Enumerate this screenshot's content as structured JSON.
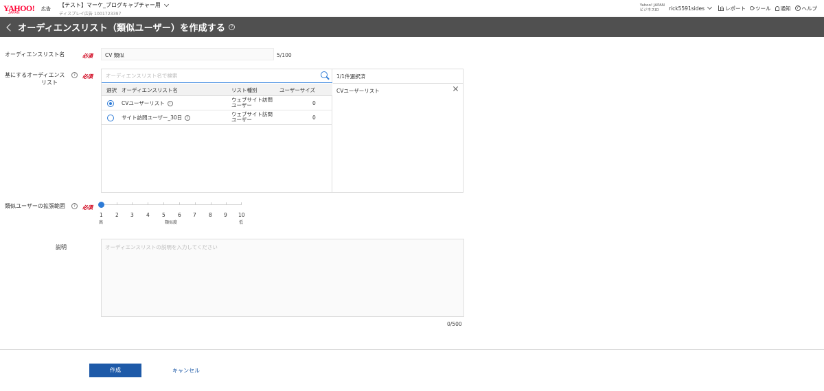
{
  "header": {
    "logo_text": "YAHOO!",
    "logo_sub": "JAPAN",
    "ad_label": "広告",
    "account_name": "【テスト】マーケ_ブログキャプチャー用",
    "account_sub": "ディスプレイ広告 1001723397",
    "business_id_line1": "Yahoo! JAPAN",
    "business_id_line2": "ビジネスID",
    "username": "rick5591sides",
    "nav": [
      "レポート",
      "ツール",
      "通知",
      "ヘルプ"
    ]
  },
  "page": {
    "title": "オーディエンスリスト（類似ユーザー）を作成する",
    "help_glyph": "?"
  },
  "form": {
    "required_label": "必須",
    "name": {
      "label": "オーディエンスリスト名",
      "value": "CV 類似",
      "counter": "5/100"
    },
    "base": {
      "label_line1": "基にするオーディエンス",
      "label_line2": "リスト",
      "search_placeholder": "オーディエンスリスト名で検索",
      "columns": [
        "選択",
        "オーディエンスリスト名",
        "リスト種別",
        "ユーザーサイズ"
      ],
      "rows": [
        {
          "name": "CVユーザーリスト",
          "type_line1": "ウェブサイト訪問",
          "type_line2": "ユーザー",
          "size": "0",
          "selected": true
        },
        {
          "name": "サイト訪問ユーザー_30日",
          "type_line1": "ウェブサイト訪問",
          "type_line2": "ユーザー",
          "size": "0",
          "selected": false
        }
      ],
      "selected_count": "1/1件選択済",
      "selected_item": "CVユーザーリスト"
    },
    "expansion": {
      "label": "類似ユーザーの拡張範囲",
      "value": 1,
      "ticks": [
        "1",
        "2",
        "3",
        "4",
        "5",
        "6",
        "7",
        "8",
        "9",
        "10"
      ],
      "scale_high": "高",
      "scale_mid": "類似度",
      "scale_low": "低"
    },
    "description": {
      "label": "説明",
      "placeholder": "オーディエンスリストの説明を入力してください",
      "counter": "0/500"
    }
  },
  "actions": {
    "create": "作成",
    "cancel": "キャンセル"
  },
  "colors": {
    "title_bar": "#505050",
    "accent": "#2e7bd6",
    "primary_button": "#1e5aa8",
    "required": "#d0021b",
    "logo": "#ff0033"
  }
}
